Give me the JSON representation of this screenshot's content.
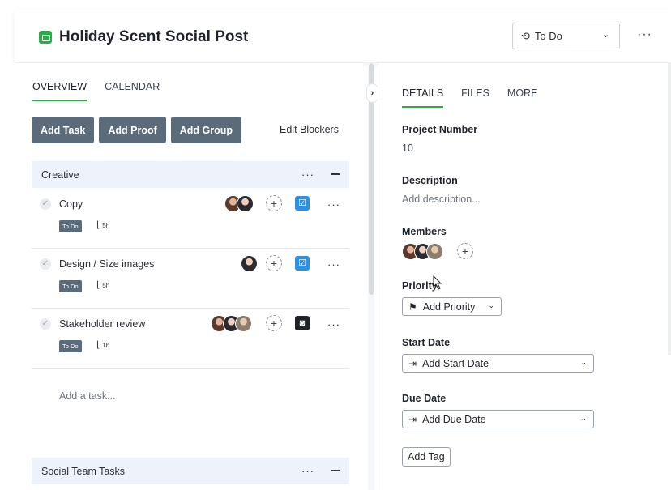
{
  "header": {
    "title": "Holiday Scent Social Post",
    "status": "To Do",
    "more": "···",
    "status_icon": "status-cycle-icon",
    "accent_color": "#2eaa4a"
  },
  "left": {
    "tabs": [
      "OVERVIEW",
      "CALENDAR"
    ],
    "buttons": {
      "add_task": "Add Task",
      "add_proof": "Add Proof",
      "add_group": "Add Group",
      "edit_blockers": "Edit Blockers"
    },
    "groups": [
      {
        "name": "Creative",
        "tasks": [
          {
            "name": "Copy",
            "status": "To Do",
            "effort": "5h"
          },
          {
            "name": "Design / Size images",
            "status": "To Do",
            "effort": "5h"
          },
          {
            "name": "Stakeholder review",
            "status": "To Do",
            "effort": "1h"
          }
        ]
      },
      {
        "name": "Social Team Tasks"
      }
    ],
    "add_task_placeholder": "Add a task..."
  },
  "right": {
    "tabs": [
      "DETAILS",
      "FILES",
      "MORE"
    ],
    "project_number_label": "Project Number",
    "project_number": "10",
    "description_label": "Description",
    "description_placeholder": "Add description...",
    "members_label": "Members",
    "priority_label": "Priority",
    "priority_button": "Add Priority",
    "start_date_label": "Start Date",
    "start_date_button": "Add Start Date",
    "due_date_label": "Due Date",
    "due_date_button": "Add Due Date",
    "add_tag": "Add Tag"
  }
}
